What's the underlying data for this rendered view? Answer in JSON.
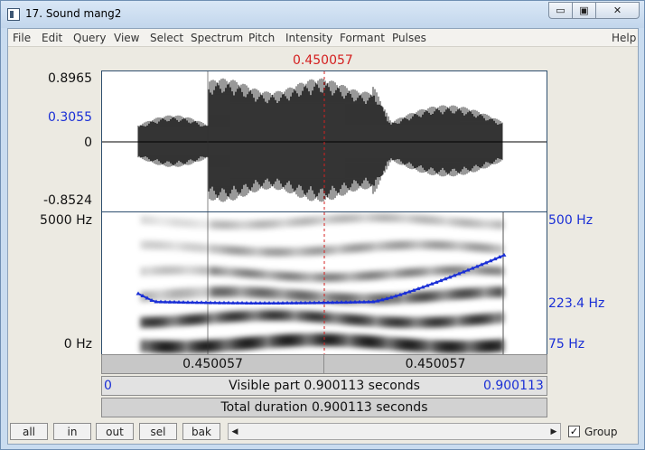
{
  "window": {
    "title": "17. Sound mang2",
    "minimize_glyph": "▭",
    "maximize_glyph": "▣",
    "close_glyph": "✕"
  },
  "menu": [
    "File",
    "Edit",
    "Query",
    "View",
    "Select",
    "Spectrum",
    "Pitch",
    "Intensity",
    "Formant",
    "Pulses",
    "Help"
  ],
  "cursor": {
    "time_label": "0.450057",
    "time": 0.450057
  },
  "waveform": {
    "y_max": "0.8965",
    "y_cursor": "0.3055",
    "y_zero": "0",
    "y_min": "-0.8524"
  },
  "spectrogram": {
    "freq_max": "5000 Hz",
    "freq_min": "0 Hz",
    "pitch_max": "500 Hz",
    "pitch_current": "223.4 Hz",
    "pitch_min": "75 Hz"
  },
  "time_strip": {
    "left_label": "0.450057",
    "right_label": "0.450057"
  },
  "visible_strip": {
    "start": "0",
    "label": "Visible part 0.900113 seconds",
    "end": "0.900113"
  },
  "total_strip": {
    "label": "Total duration 0.900113 seconds"
  },
  "buttons": {
    "all": "all",
    "in": "in",
    "out": "out",
    "sel": "sel",
    "bak": "bak"
  },
  "scroll": {
    "left_arrow": "◀",
    "right_arrow": "▶"
  },
  "group": {
    "label": "Group",
    "checked": true,
    "check_glyph": "✓"
  },
  "colors": {
    "cursor": "#d42020",
    "pitch": "#1a2fd6",
    "panel_border": "#2e4e6e"
  }
}
